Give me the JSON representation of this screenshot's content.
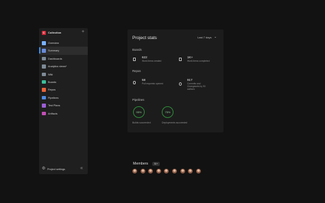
{
  "sidebar": {
    "org_initial": "C",
    "org_name": "Collection",
    "add_symbol": "+",
    "items": [
      {
        "label": "Overview",
        "icon": "overview-icon",
        "color": "#7ab2ff",
        "active": false
      },
      {
        "label": "Summary",
        "icon": "summary-icon",
        "color": "#6a8bd6",
        "active": true
      },
      {
        "label": "Dashboards",
        "icon": "dashboards-icon",
        "color": "#7e8a96",
        "active": false
      },
      {
        "label": "Analytics views*",
        "icon": "analytics-icon",
        "color": "#7e8a96",
        "active": false
      },
      {
        "label": "Wiki",
        "icon": "wiki-icon",
        "color": "#7e8a96",
        "active": false
      },
      {
        "label": "Boards",
        "icon": "boards-icon",
        "color": "#3cbf9a",
        "active": false
      },
      {
        "label": "Repos",
        "icon": "repos-icon",
        "color": "#e8643a",
        "active": false
      },
      {
        "label": "Pipelines",
        "icon": "pipelines-icon",
        "color": "#4f8be0",
        "active": false
      },
      {
        "label": "Test Plans",
        "icon": "test-plans-icon",
        "color": "#9c5fd6",
        "active": false
      },
      {
        "label": "Artifacts",
        "icon": "artifacts-icon",
        "color": "#c24fb6",
        "active": false
      }
    ],
    "footer": {
      "settings_label": "Project settings",
      "collapse_symbol": "«"
    }
  },
  "stats": {
    "title": "Project stats",
    "period": "Last 7 days",
    "boards": {
      "label": "Boards",
      "created_value": "622",
      "created_desc": "Work items created",
      "completed_value": "1K+",
      "completed_desc": "Work items completed"
    },
    "repos": {
      "label": "Repos",
      "prs_value": "58",
      "prs_desc": "Pull requests opened",
      "commits_value": "917",
      "commits_desc": "Commits and Changesets by 90 authors"
    },
    "pipelines": {
      "label": "Pipelines",
      "build_value": "95%",
      "build_desc": "Builds succeeded",
      "deploy_value": "75%",
      "deploy_desc": "Deployments succeeded"
    }
  },
  "members": {
    "title": "Members",
    "count": "30+",
    "avatar_count": 9
  }
}
